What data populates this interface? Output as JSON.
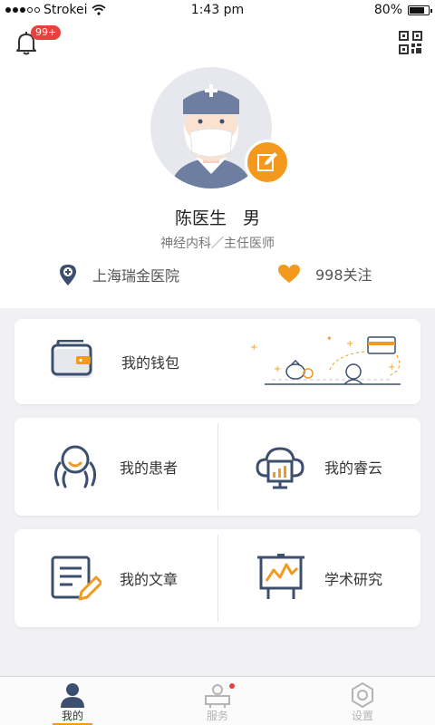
{
  "status_bar": {
    "carrier": "Strokei",
    "time": "1:43 pm",
    "battery": "80%",
    "battery_level": 0.8
  },
  "header": {
    "notification_badge": "99+"
  },
  "profile": {
    "name": "陈医生",
    "gender": "男",
    "department": "神经内科／主任医师",
    "hospital": "上海瑞金医院",
    "followers": "998关注"
  },
  "menu": {
    "wallet": "我的钱包",
    "patients": "我的患者",
    "cloud": "我的睿云",
    "articles": "我的文章",
    "research": "学术研究"
  },
  "tabs": [
    {
      "label": "我的",
      "active": true
    },
    {
      "label": "服务",
      "active": false
    },
    {
      "label": "设置",
      "active": false
    }
  ],
  "colors": {
    "accent": "#f39a1e",
    "icon_navy": "#3d4f6e",
    "badge": "#e8413b"
  }
}
